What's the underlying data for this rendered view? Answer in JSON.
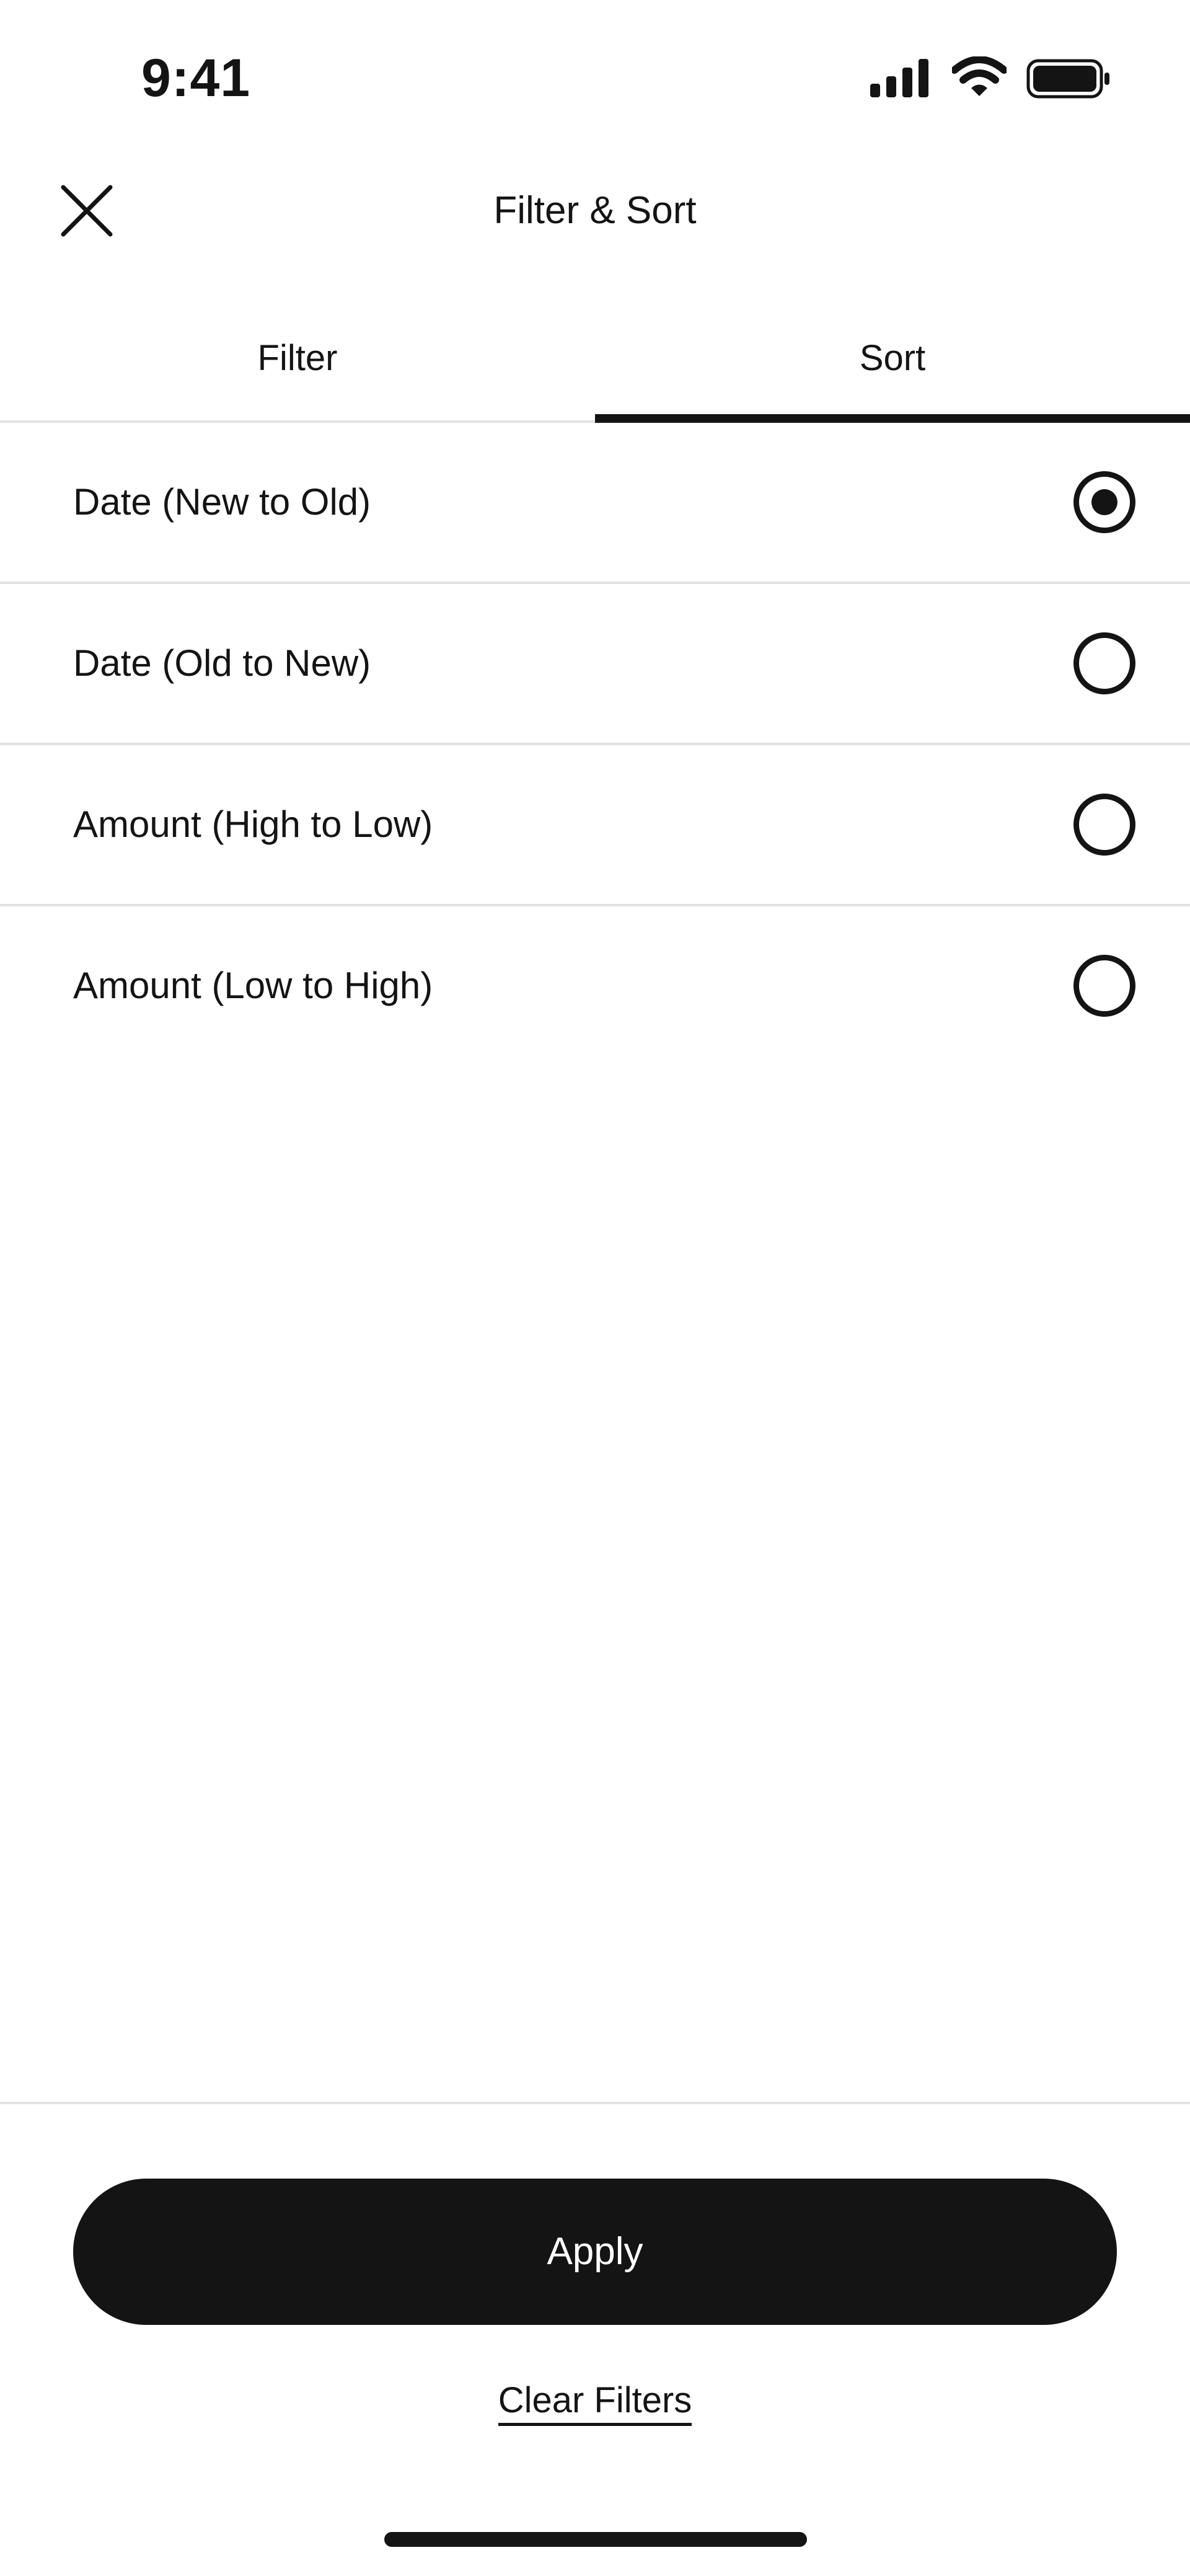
{
  "status_bar": {
    "time": "9:41",
    "icons": [
      "cellular-signal-icon",
      "wifi-icon",
      "battery-icon"
    ]
  },
  "header": {
    "title": "Filter & Sort",
    "close_icon": "close-icon"
  },
  "tabs": [
    {
      "label": "Filter",
      "selected": false
    },
    {
      "label": "Sort",
      "selected": true
    }
  ],
  "sort_options": [
    {
      "label": "Date (New to Old)",
      "selected": true
    },
    {
      "label": "Date (Old to New)",
      "selected": false
    },
    {
      "label": "Amount (High to Low)",
      "selected": false
    },
    {
      "label": "Amount (Low to High)",
      "selected": false
    }
  ],
  "footer": {
    "apply_label": "Apply",
    "clear_label": "Clear Filters"
  },
  "colors": {
    "ink": "#141414",
    "divider": "#e2e2e2",
    "background": "#ffffff"
  }
}
